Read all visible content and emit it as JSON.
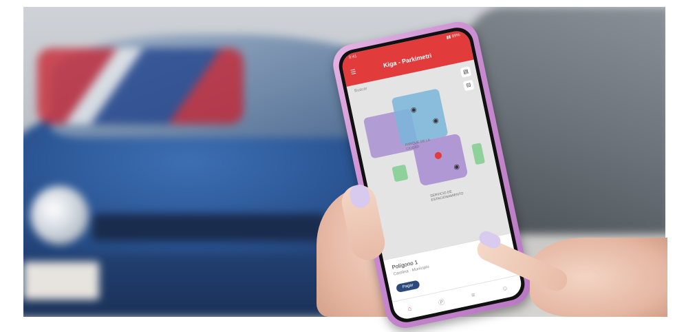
{
  "phone_app": {
    "status_left": "9:41",
    "status_right": "▮▮ 89%",
    "title": "Kiga - Parkimetri",
    "menu_glyph": "☰",
    "search_hint": "Buscar",
    "map_label_center": "PARQUE DE LA CIUDAD",
    "map_label_lower": "SERVICIO DE ESTACIONAMIENTO",
    "card_title": "Polígono 1",
    "card_subtitle": "Carolina · Municipio",
    "card_button": "Pagar"
  },
  "colors": {
    "appbar": "#e23b3b",
    "zone_purple": "#a98fd1",
    "zone_blue": "#79b6d9",
    "zone_green": "#8fd19a"
  }
}
